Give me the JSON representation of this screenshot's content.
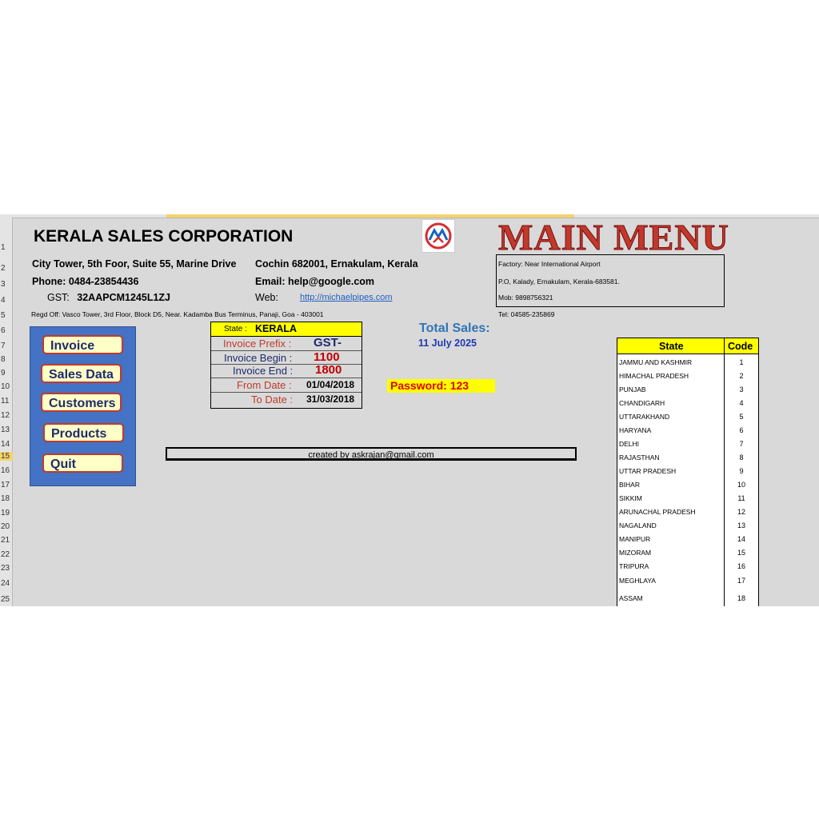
{
  "company": {
    "name": "KERALA SALES CORPORATION",
    "address": "City Tower, 5th Foor, Suite 55,  Marine Drive",
    "city": "Cochin 682001, Ernakulam, Kerala",
    "phone_label": "Phone:",
    "phone": "0484-23854436",
    "email_label": "Email:",
    "email": "help@google.com",
    "gst_label": "GST:",
    "gst": "32AAPCM1245L1ZJ",
    "web_label": "Web:",
    "web": "http://michaelpipes.com",
    "regd_off": "Regd Off: Vasco Tower, 3rd Floor, Block D5, Near. Kadamba Bus Terminus, Panaji, Goa - 403001"
  },
  "menu_title": "MAIN MENU",
  "factory": {
    "line1": "Factory: Near International Airport",
    "line2": "P.O, Kalady, Ernakulam, Kerala-683581.",
    "mob": "Mob: 9898756321",
    "tel": "Tel: 04585-235869"
  },
  "buttons": {
    "invoice": "Invoice",
    "sales_data": "Sales Data",
    "customers": "Customers",
    "products": "Products",
    "quit": "Quit"
  },
  "invoice_info": {
    "state_label": "State :",
    "state": "KERALA",
    "prefix_label": "Invoice Prefix :",
    "prefix": "GST-",
    "begin_label": "Invoice Begin :",
    "begin": "1100",
    "end_label": "Invoice End :",
    "end": "1800",
    "from_label": "From Date :",
    "from": "01/04/2018",
    "to_label": "To Date :",
    "to": "31/03/2018"
  },
  "total_sales": {
    "label": "Total Sales:",
    "date": "11 July 2025"
  },
  "password": "Password: 123",
  "created_by": "created by askrajan@gmail.com",
  "state_table": {
    "header_state": "State",
    "header_code": "Code",
    "rows": [
      {
        "state": "JAMMU AND KASHMIR",
        "code": "1"
      },
      {
        "state": "HIMACHAL PRADESH",
        "code": "2"
      },
      {
        "state": "PUNJAB",
        "code": "3"
      },
      {
        "state": "CHANDIGARH",
        "code": "4"
      },
      {
        "state": "UTTARAKHAND",
        "code": "5"
      },
      {
        "state": "HARYANA",
        "code": "6"
      },
      {
        "state": "DELHI",
        "code": "7"
      },
      {
        "state": "RAJASTHAN",
        "code": "8"
      },
      {
        "state": "UTTAR  PRADESH",
        "code": "9"
      },
      {
        "state": "BIHAR",
        "code": "10"
      },
      {
        "state": "SIKKIM",
        "code": "11"
      },
      {
        "state": "ARUNACHAL PRADESH",
        "code": "12"
      },
      {
        "state": "NAGALAND",
        "code": "13"
      },
      {
        "state": "MANIPUR",
        "code": "14"
      },
      {
        "state": "MIZORAM",
        "code": "15"
      },
      {
        "state": "TRIPURA",
        "code": "16"
      },
      {
        "state": "MEGHLAYA",
        "code": "17"
      },
      {
        "state": "ASSAM",
        "code": "18"
      }
    ]
  },
  "row_numbers": [
    "1",
    "2",
    "3",
    "4",
    "5",
    "6",
    "7",
    "8",
    "9",
    "10",
    "11",
    "12",
    "13",
    "14",
    "15",
    "16",
    "17",
    "18",
    "19",
    "20",
    "21",
    "22",
    "23",
    "24",
    "25"
  ],
  "selected_row": "15",
  "colors": {
    "accent_red": "#c0392b",
    "panel_blue": "#4472c4",
    "highlight_yellow": "#ffff00",
    "navy_text": "#1f2a6b"
  }
}
